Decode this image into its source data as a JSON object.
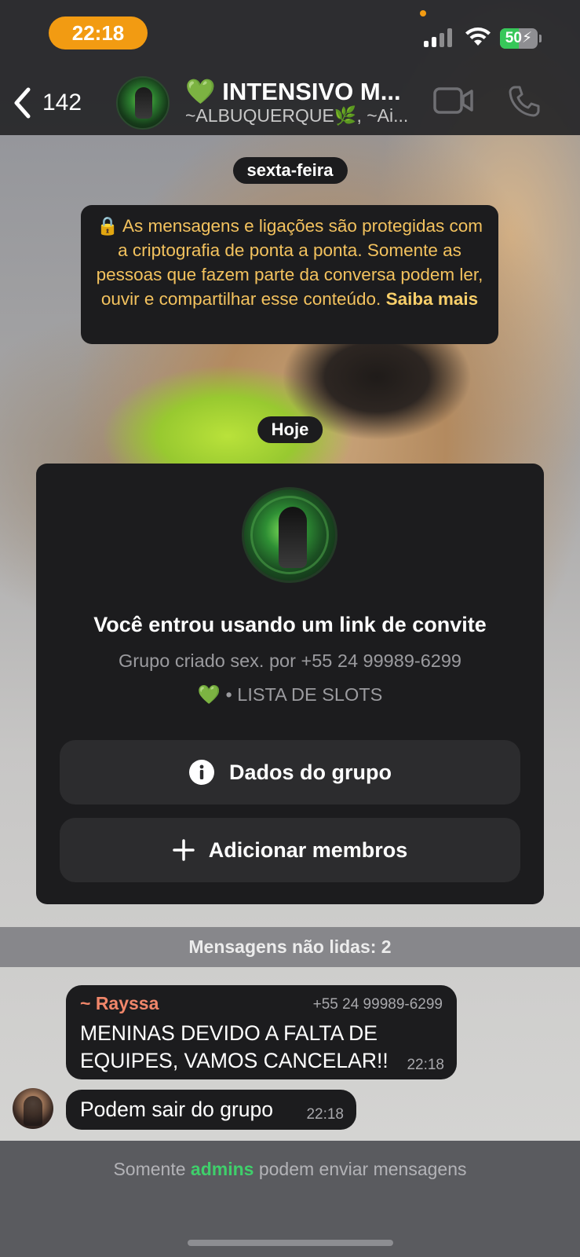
{
  "status_bar": {
    "time": "22:18",
    "battery": "50",
    "battery_level": 0.5
  },
  "header": {
    "back_count": "142",
    "title": "💚 INTENSIVO M...",
    "subtitle": "~ALBUQUERQUE🌿, ~Ai..."
  },
  "chat": {
    "date_friday": "sexta-feira",
    "encryption_text": "🔒 As mensagens e ligações são protegidas com a criptografia de ponta a ponta. Somente as pessoas que fazem parte da conversa podem ler, ouvir e compartilhar esse conteúdo.",
    "encryption_link": "Saiba mais",
    "date_today": "Hoje",
    "group_card": {
      "title": "Você entrou usando um link de convite",
      "subtitle": "Grupo criado sex. por +55 24 99989-6299",
      "description": "💚 • LISTA DE SLOTS",
      "info_button": "Dados do grupo",
      "add_button": "Adicionar membros"
    },
    "unread_label": "Mensagens não lidas: 2",
    "messages": [
      {
        "sender": "~ Rayssa",
        "phone": "+55 24 99989-6299",
        "lines": [
          "MENINAS DEVIDO A FALTA DE",
          "EQUIPES, VAMOS CANCELAR!!"
        ],
        "time": "22:18"
      },
      {
        "text": "Podem sair do grupo",
        "time": "22:18"
      }
    ]
  },
  "footer": {
    "note_prefix": "Somente",
    "note_highlight": "admins",
    "note_suffix": "podem enviar mensagens"
  },
  "colors": {
    "status_pill": "#f29b12",
    "encryption_text": "#f3c25e",
    "sender_name": "#f0866a",
    "admins_highlight": "#3fcf6b",
    "battery_fill": "#37c759"
  }
}
